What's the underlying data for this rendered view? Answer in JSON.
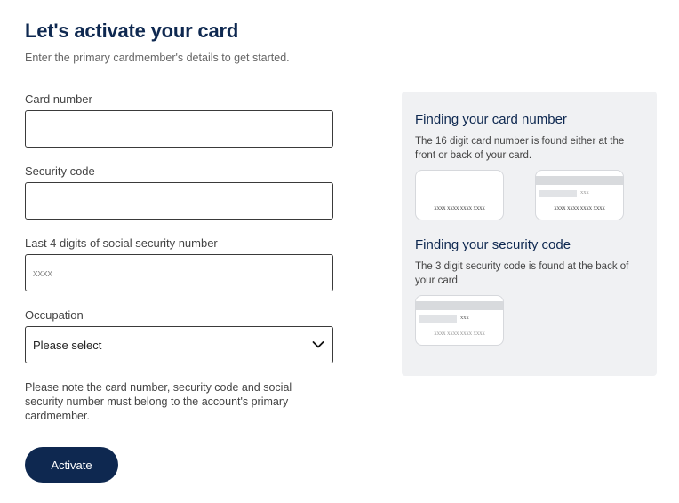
{
  "page": {
    "title": "Let's activate your card",
    "subtitle": "Enter the primary cardmember's details to get started."
  },
  "form": {
    "card_number": {
      "label": "Card number",
      "value": "",
      "placeholder": ""
    },
    "security_code": {
      "label": "Security code",
      "value": "",
      "placeholder": ""
    },
    "ssn_last4": {
      "label": "Last 4 digits of social security number",
      "value": "",
      "placeholder": "xxxx"
    },
    "occupation": {
      "label": "Occupation",
      "selected": "Please select",
      "icon": "chevron-down-icon"
    },
    "note": "Please note the card number, security code and social security number must belong to the account's primary cardmember.",
    "activate_label": "Activate"
  },
  "help": {
    "card_number": {
      "title": "Finding your card number",
      "text": "The 16 digit card number is found either at the front or back of your card.",
      "front_card_number": "xxxx xxxx xxxx xxxx",
      "back_card_code": "xxx",
      "back_card_number": "xxxx xxxx xxxx xxxx"
    },
    "security_code": {
      "title": "Finding your security code",
      "text": "The 3 digit security code is found at the back of your card.",
      "back_card_code": "xxx",
      "back_card_number": "xxxx xxxx xxxx xxxx"
    }
  },
  "colors": {
    "brand_navy": "#0e2850",
    "panel_bg": "#f0f1f3",
    "border": "#3a3a3a"
  }
}
